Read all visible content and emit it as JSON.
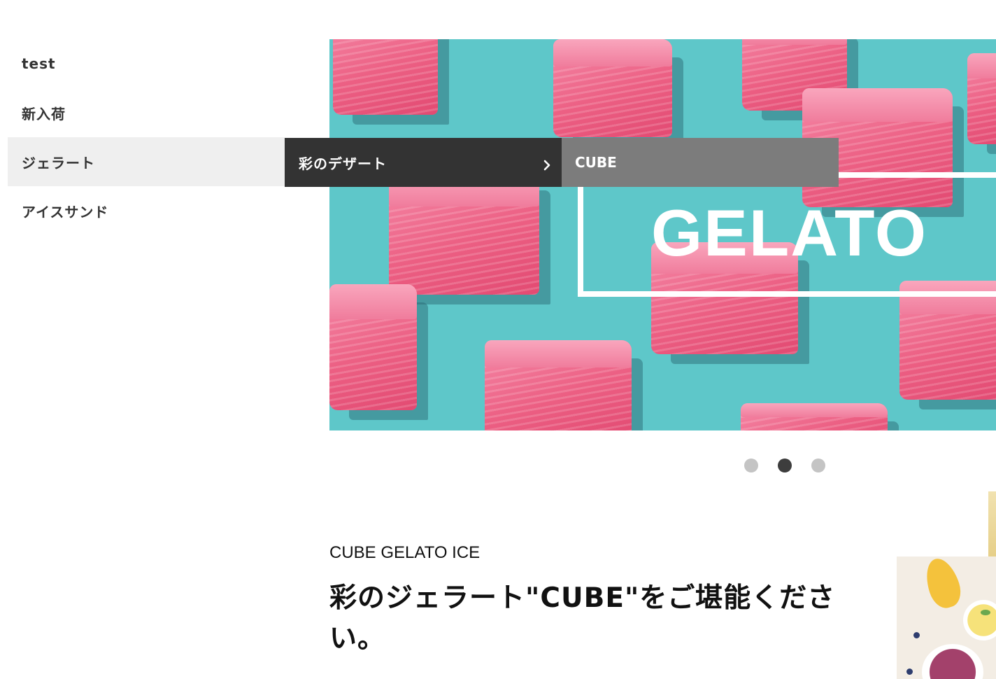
{
  "nav": {
    "items": [
      {
        "label": "test"
      },
      {
        "label": "新入荷"
      },
      {
        "label": "ジェラート"
      },
      {
        "label": "アイスサンド"
      }
    ]
  },
  "submenu": {
    "level1": {
      "label": "彩のデザート",
      "icon": "chevron-right-icon"
    },
    "level2": {
      "label": "CUBE"
    }
  },
  "hero": {
    "title": "GELATO",
    "colors": {
      "background": "#5ec7c9",
      "gelato": "#ec5f83",
      "frame": "#ffffff"
    }
  },
  "carousel": {
    "count": 3,
    "active_index": 1
  },
  "content": {
    "eyebrow": "CUBE GELATO ICE",
    "headline": "彩のジェラート\"CUBE\"をご堪能ください。"
  },
  "colors": {
    "submenu_dark": "#333333",
    "submenu_gray": "#7c7c7c",
    "nav_active_bg": "#efefef",
    "text": "#333333"
  }
}
